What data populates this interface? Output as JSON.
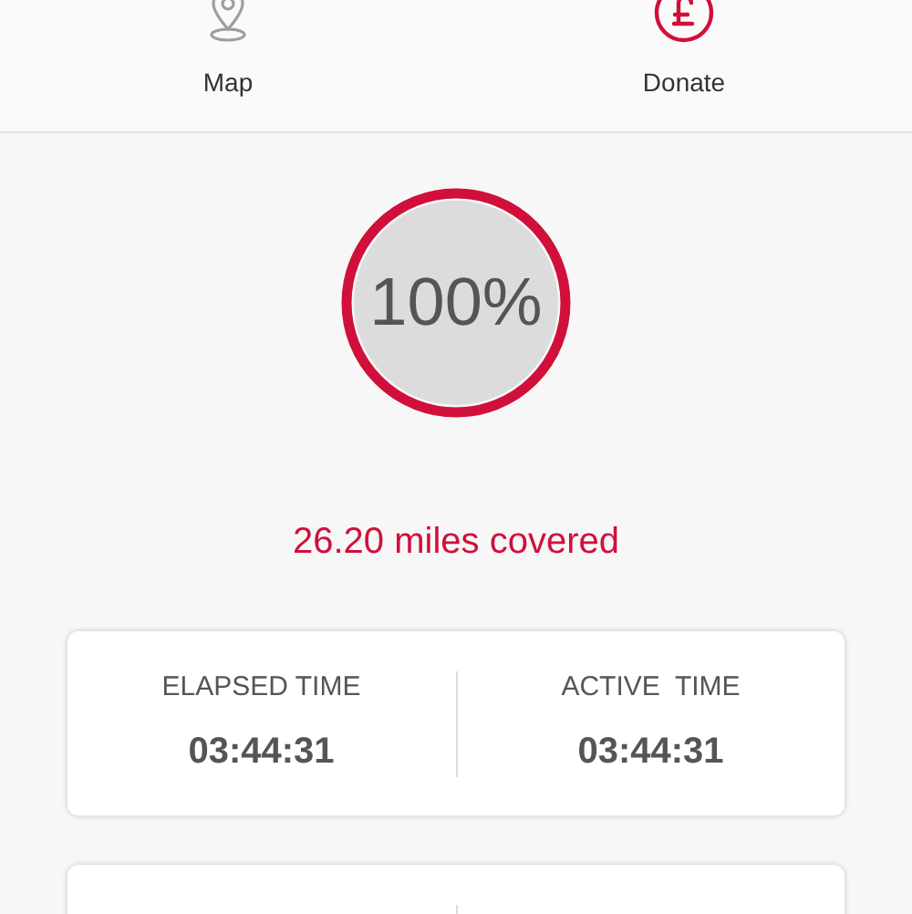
{
  "nav": [
    {
      "kind": "map",
      "label": "Map",
      "color": "#9e9e9e"
    },
    {
      "kind": "donate",
      "label": "Donate",
      "color": "#d0103a"
    }
  ],
  "progress": {
    "percent": "100%"
  },
  "distance": "26.20 miles covered",
  "stats": [
    {
      "label": "ELAPSED TIME",
      "value": "03:44:31"
    },
    {
      "label": "ACTIVE  TIME",
      "value": "03:44:31"
    }
  ]
}
